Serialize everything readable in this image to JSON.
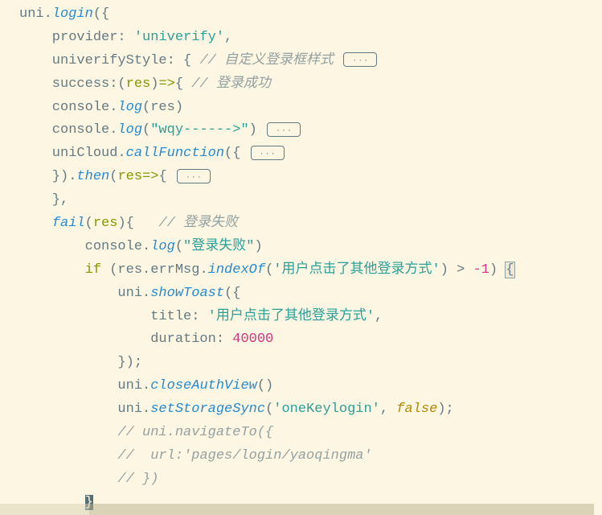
{
  "code": {
    "l1": {
      "a": "uni",
      "b": ".",
      "c": "login",
      "d": "({"
    },
    "l2": {
      "a": "    provider: ",
      "b": "'univerify'",
      "c": ","
    },
    "l3": {
      "a": "    univerifyStyle: { ",
      "b": "// 自定义登录框样式 "
    },
    "l4": {
      "a": "    success:",
      "b": "(",
      "c": "res",
      "d": ")",
      "e": "=>",
      "f": "{ ",
      "g": "// 登录成功"
    },
    "l5": {
      "a": "    console.",
      "b": "log",
      "c": "(res)"
    },
    "l6": {
      "a": "    console.",
      "b": "log",
      "c": "(",
      "d": "\"wqy------>\"",
      "e": ") "
    },
    "l7": {
      "a": "    uniCloud.",
      "b": "callFunction",
      "c": "({ "
    },
    "l8": {
      "a": "    }).",
      "b": "then",
      "c": "(",
      "d": "res",
      "e": "=>",
      "f": "{ "
    },
    "l9": {
      "a": "    },"
    },
    "l10": {
      "a": "    ",
      "b": "fail",
      "c": "(",
      "d": "res",
      "e": "){   ",
      "f": "// 登录失败"
    },
    "l11": {
      "a": "        console.",
      "b": "log",
      "c": "(",
      "d": "\"登录失败\"",
      "e": ")"
    },
    "l12": {
      "a": "        ",
      "b": "if",
      "c": " (res.errMsg.",
      "d": "indexOf",
      "e": "(",
      "f": "'用户点击了其他登录方式'",
      "g": ") > ",
      "h": "-1",
      "i": ") ",
      "j": "{"
    },
    "l13": {
      "a": "            uni.",
      "b": "showToast",
      "c": "({"
    },
    "l14": {
      "a": "                title: ",
      "b": "'用户点击了其他登录方式'",
      "c": ","
    },
    "l15": {
      "a": "                duration: ",
      "b": "40000"
    },
    "l16": {
      "a": "            });"
    },
    "l17": {
      "a": "            uni.",
      "b": "closeAuthView",
      "c": "()"
    },
    "l18": {
      "a": "            uni.",
      "b": "setStorageSync",
      "c": "(",
      "d": "'oneKeylogin'",
      "e": ", ",
      "f": "false",
      "g": ");"
    },
    "l19": {
      "a": "            ",
      "b": "// uni.navigateTo({"
    },
    "l20": {
      "a": "            ",
      "b": "//  url:'pages/login/yaoqingma'"
    },
    "l21": {
      "a": "            ",
      "b": "// })"
    },
    "l22": {
      "a": "        ",
      "b": "}"
    }
  },
  "fold_label": "···"
}
